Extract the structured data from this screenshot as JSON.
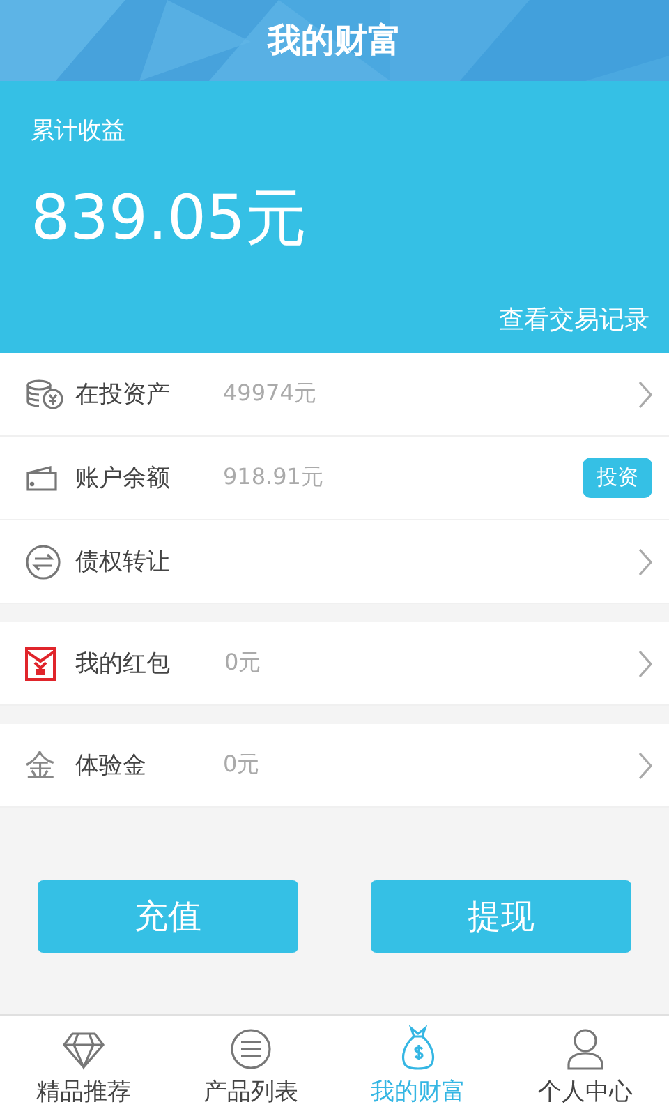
{
  "header": {
    "title": "我的财富"
  },
  "summary": {
    "label": "累计收益",
    "amount": "839.05元",
    "link": "查看交易记录"
  },
  "groups": [
    {
      "rows": [
        {
          "kind": "coins",
          "label": "在投资产",
          "value": "49974元"
        },
        {
          "kind": "wallet",
          "label": "账户余额",
          "value": "918.91元",
          "button": "投资"
        },
        {
          "kind": "transfer",
          "label": "债权转让"
        }
      ]
    },
    {
      "rows": [
        {
          "kind": "envelope",
          "label": "我的红包",
          "value": "0元"
        }
      ]
    },
    {
      "rows": [
        {
          "kind": "glyph",
          "icon_text": "金",
          "label": "体验金",
          "value": "0元"
        }
      ]
    }
  ],
  "buttons": [
    "充值",
    "提现"
  ],
  "tabs": [
    {
      "label": "精品推荐",
      "selected": false
    },
    {
      "label": "产品列表",
      "selected": false
    },
    {
      "label": "我的财富",
      "selected": true
    },
    {
      "label": "个人中心",
      "selected": false
    }
  ]
}
